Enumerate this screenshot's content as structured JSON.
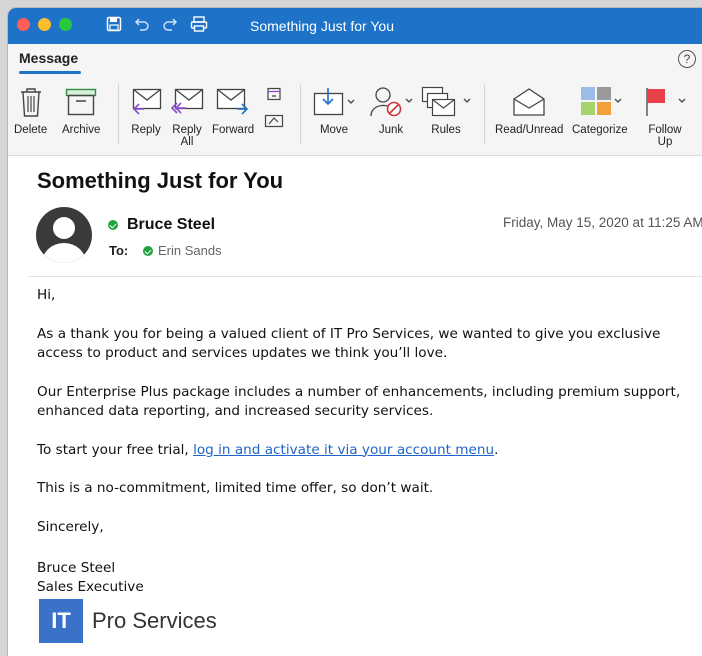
{
  "window": {
    "title": "Something Just for You"
  },
  "ribbon": {
    "tab": "Message",
    "help": "?",
    "buttons": {
      "delete": "Delete",
      "archive": "Archive",
      "reply": "Reply",
      "reply_all": "Reply\nAll",
      "forward": "Forward",
      "move": "Move",
      "junk": "Junk",
      "rules": "Rules",
      "read_unread": "Read/Unread",
      "categorize": "Categorize",
      "follow_up": "Follow\nUp"
    }
  },
  "message": {
    "subject": "Something Just for You",
    "sender": "Bruce Steel",
    "to_label": "To:",
    "recipient": "Erin Sands",
    "date": "Friday, May 15, 2020 at 11:25 AM",
    "greeting": "Hi,",
    "p1": "As a thank you for being a valued client of IT Pro Services, we wanted to give you exclusive access to product and services updates we think you’ll love.",
    "p2": "Our Enterprise Plus package includes a number of enhancements, including premium support, enhanced data reporting, and increased security services.",
    "p3_prefix": "To start your free trial, ",
    "p3_link": "log in and activate it via your account menu",
    "p3_suffix": ".",
    "p4": "This is a no-commitment, limited time offer, so don’t wait.",
    "closing": "Sincerely,",
    "sig_name": "Bruce Steel",
    "sig_title": "Sales Executive",
    "logo_mark": "IT",
    "logo_text": "Pro Services"
  },
  "colors": {
    "titlebar": "#1e72c8",
    "link": "#1f64c8",
    "online": "#22a33f",
    "logo": "#3b72c9"
  }
}
